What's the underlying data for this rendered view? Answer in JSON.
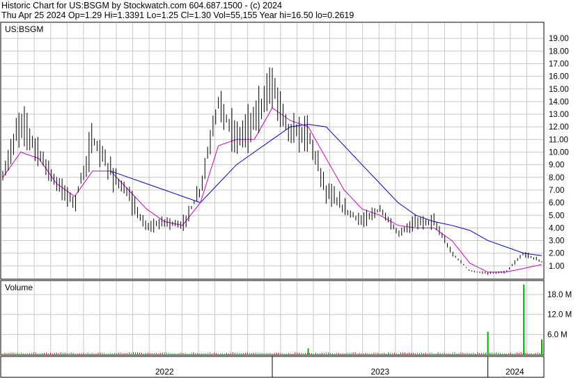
{
  "header": {
    "line1": "Historic Chart for US:BSGM by Stockwatch.com 604.687.1500 - (c) 2024",
    "line2": "Thu Apr 25 2024   Op=1.29   Hi=1.3391   Lo=1.25   Cl=1.30   Vol=55,155   Year hi=16.50   lo=0.2619"
  },
  "chart_data": [
    {
      "type": "line",
      "title": "US:BSGM",
      "ylim": [
        0,
        20
      ],
      "y_ticks": [
        "1.00",
        "2.00",
        "3.00",
        "4.00",
        "5.00",
        "6.00",
        "7.00",
        "8.00",
        "9.00",
        "10.00",
        "11.00",
        "12.00",
        "13.00",
        "14.00",
        "15.00",
        "16.00",
        "17.00",
        "18.00",
        "19.00"
      ],
      "x_labels": [
        "2022",
        "2023",
        "2024"
      ],
      "colors": {
        "price": "#000000",
        "ma_fast": "#cc00cc",
        "ma_slow": "#0000cc",
        "grid": "#c8c8c8"
      },
      "x": [
        "2021-10",
        "2021-11",
        "2021-12",
        "2022-01",
        "2022-02",
        "2022-03",
        "2022-04",
        "2022-05",
        "2022-06",
        "2022-07",
        "2022-08",
        "2022-09",
        "2022-10",
        "2022-11",
        "2022-12",
        "2023-01",
        "2023-02",
        "2023-03",
        "2023-04",
        "2023-05",
        "2023-06",
        "2023-07",
        "2023-08",
        "2023-09",
        "2023-10",
        "2023-11",
        "2023-12",
        "2024-01",
        "2024-02",
        "2024-03",
        "2024-04"
      ],
      "series": [
        {
          "values": [
            8.0,
            12.5,
            10.0,
            7.5,
            6.0,
            11.0,
            8.5,
            6.5,
            4.0,
            4.5,
            4.2,
            7.0,
            14.0,
            11.0,
            12.5,
            15.5,
            11.5,
            11.5,
            7.0,
            5.5,
            4.5,
            5.5,
            3.5,
            4.5,
            4.5,
            2.0,
            0.6,
            0.4,
            0.5,
            2.0,
            1.3
          ]
        },
        {
          "values": [
            8.0,
            10.0,
            9.5,
            7.5,
            6.5,
            8.5,
            8.5,
            7.0,
            5.5,
            4.5,
            4.2,
            6.0,
            10.5,
            11.0,
            11.0,
            13.5,
            12.5,
            12.0,
            9.5,
            7.0,
            5.5,
            5.0,
            4.2,
            4.0,
            4.0,
            3.0,
            1.2,
            0.5,
            0.5,
            0.8,
            1.1
          ]
        },
        {
          "values": [
            null,
            null,
            null,
            null,
            null,
            null,
            8.5,
            8.0,
            7.5,
            7.0,
            6.5,
            6.0,
            7.5,
            9.0,
            10.0,
            11.0,
            12.0,
            12.2,
            12.0,
            10.5,
            9.0,
            7.5,
            6.0,
            5.0,
            4.5,
            4.2,
            3.8,
            3.0,
            2.5,
            2.0,
            1.8
          ]
        }
      ]
    },
    {
      "type": "bar",
      "title": "Volume",
      "y_ticks": [
        "6.0 M",
        "12.0 M",
        "18.0 M"
      ],
      "ylim": [
        0,
        22
      ],
      "x": [
        "2023-03",
        "2024-01",
        "2024-03",
        "2024-04"
      ],
      "series": [
        {
          "values": [
            1.8,
            6.8,
            21.0,
            4.5
          ]
        }
      ]
    }
  ]
}
